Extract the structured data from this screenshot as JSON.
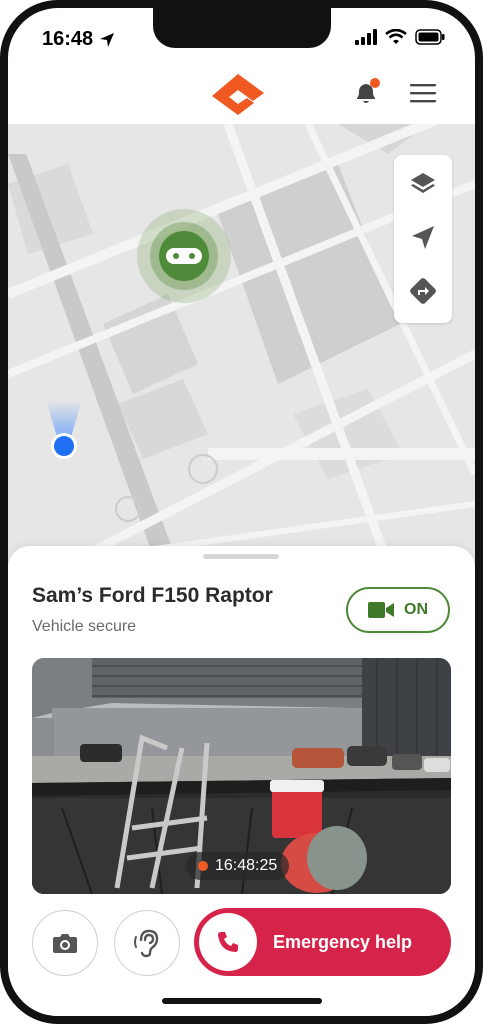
{
  "status_bar": {
    "time": "16:48"
  },
  "vehicle": {
    "name": "Sam’s Ford F150 Raptor",
    "status": "Vehicle secure"
  },
  "camera": {
    "toggle_label": "ON",
    "timestamp": "16:48:25"
  },
  "actions": {
    "emergency_label": "Emergency help"
  },
  "colors": {
    "brand": "#f05a22",
    "accent_green": "#4f8a3a",
    "emergency_red": "#d6234a"
  },
  "icons": [
    "location-arrow-icon",
    "cellular-signal-icon",
    "wifi-icon",
    "battery-icon",
    "brand-logo",
    "notification-bell-icon",
    "hamburger-menu-icon",
    "layers-icon",
    "navigation-arrow-icon",
    "directions-icon",
    "vehicle-marker-icon",
    "user-location-icon",
    "video-camera-icon",
    "camera-icon",
    "listen-ear-icon",
    "phone-icon"
  ]
}
